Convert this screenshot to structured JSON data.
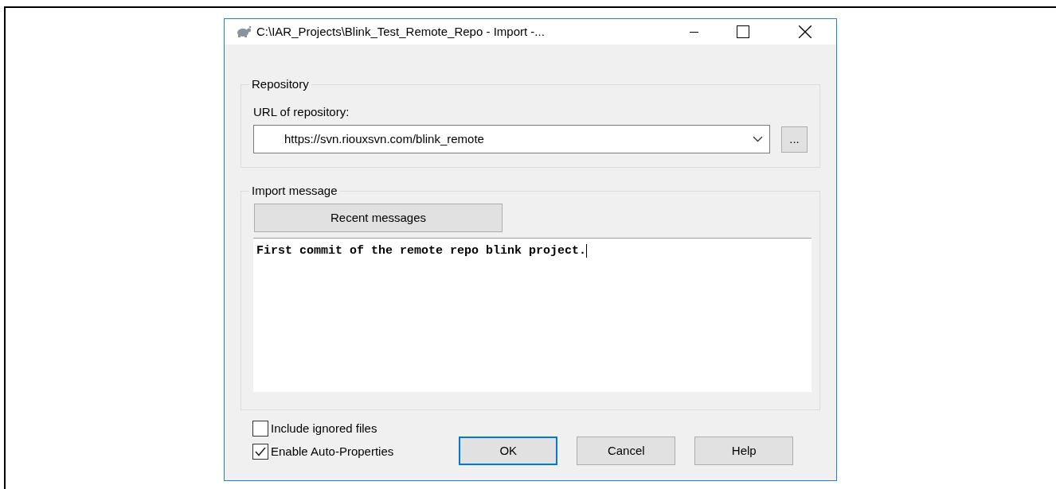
{
  "window": {
    "title": "C:\\IAR_Projects\\Blink_Test_Remote_Repo - Import -..."
  },
  "repository": {
    "group_label": "Repository",
    "url_label": "URL of repository:",
    "url_value": "https://svn.riouxsvn.com/blink_remote",
    "browse_button": "..."
  },
  "import_message": {
    "group_label": "Import message",
    "recent_button": "Recent messages",
    "message_value": "First commit of the remote repo blink project."
  },
  "options": [
    {
      "label": "Include ignored files",
      "checked": false
    },
    {
      "label": "Enable Auto-Properties",
      "checked": true
    }
  ],
  "buttons": [
    {
      "label": "OK",
      "selected": true
    },
    {
      "label": "Cancel",
      "selected": false
    },
    {
      "label": "Help",
      "selected": false
    }
  ]
}
